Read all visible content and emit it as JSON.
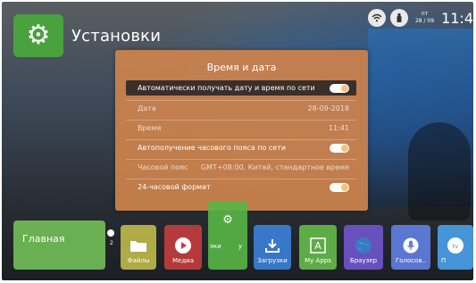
{
  "header": {
    "title": "Установки",
    "settings_icon": "gear-icon",
    "status": {
      "wifi_icon": "wifi-icon",
      "storage_icon": "usb-icon",
      "day": "пт",
      "date": "28 / 09",
      "time": "11:4"
    }
  },
  "dialog": {
    "title": "Время и дата",
    "rows": [
      {
        "label": "Автоматически получать дату и время по сети",
        "toggle": true
      },
      {
        "label": "Дата",
        "value": "28-09-2018"
      },
      {
        "label": "Время",
        "value": "11:41"
      },
      {
        "label": "Автополучение часового пояса по сети",
        "toggle": true
      },
      {
        "label": "Часовой пояс",
        "value": "GMT+08:00, Китай, стандартное время"
      },
      {
        "label": "24-часовой формат",
        "toggle": true
      }
    ]
  },
  "launcher": {
    "home": "Главная",
    "page_number": "2",
    "tiles": [
      {
        "label": "Файлы",
        "icon": "folder-icon",
        "color": "#c9c34b"
      },
      {
        "label": "Медиа",
        "icon": "play-icon",
        "color": "#c43d3d"
      },
      {
        "label": "эки",
        "icon": "gear-icon",
        "color": "#58b646"
      },
      {
        "label": "у",
        "icon": "",
        "color": "#58b646"
      },
      {
        "label": "Загрузки",
        "icon": "download-icon",
        "color": "#3a7fd6"
      },
      {
        "label": "My Apps",
        "icon": "apps-icon",
        "color": "#63b84a"
      },
      {
        "label": "Браузер",
        "icon": "globe-icon",
        "color": "#6f55c9"
      },
      {
        "label": "Голосов..",
        "icon": "microphone-icon",
        "color": "#5f7ee0"
      },
      {
        "label": "П",
        "icon": "tv-icon",
        "color": "#4a9ee6"
      }
    ]
  }
}
